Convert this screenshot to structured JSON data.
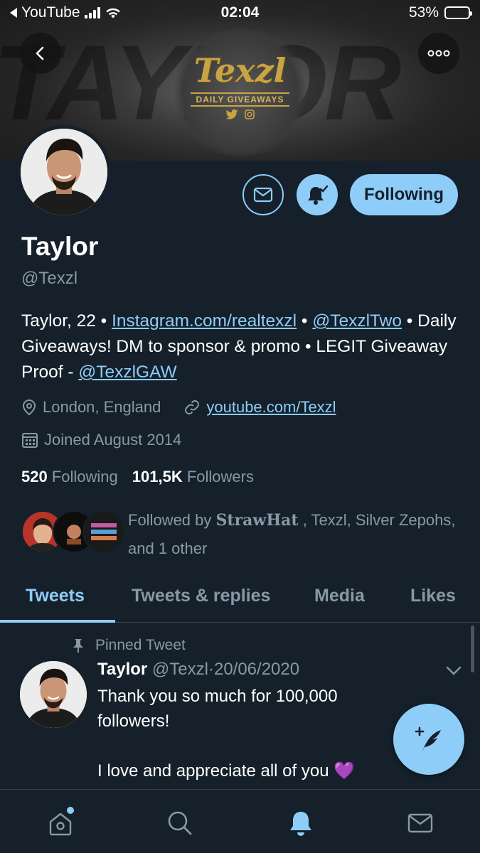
{
  "status_bar": {
    "back_app": "YouTube",
    "time": "02:04",
    "battery": "53%",
    "battery_level": 0.53
  },
  "banner": {
    "background_text": "TAYLOR",
    "logo_word": "Texzl",
    "logo_subtitle": "DAILY GIVEAWAYS"
  },
  "profile": {
    "name": "Taylor",
    "handle": "@Texzl",
    "bio": {
      "part1": "Taylor, 22 • ",
      "link1": "Instagram.com/realtexzl",
      "part2": " • ",
      "link2": "@TexzlTwo",
      "part3": " • Daily Giveaways! DM to sponsor & promo • LEGIT Giveaway Proof - ",
      "link3": "@TexzlGAW"
    },
    "location": "London, England",
    "website": "youtube.com/Texzl",
    "joined": "Joined August 2014",
    "following_count": "520",
    "following_label": "Following",
    "followers_count": "101,5K",
    "followers_label": "Followers",
    "followed_by": {
      "prefix": "Followed by ",
      "name1": "StrawHat",
      "rest": ", Texzl, Silver Zepohs, and 1 other"
    },
    "follow_button": "Following"
  },
  "tabs": [
    {
      "label": "Tweets",
      "active": true
    },
    {
      "label": "Tweets & replies",
      "active": false
    },
    {
      "label": "Media",
      "active": false
    },
    {
      "label": "Likes",
      "active": false
    }
  ],
  "pinned_tweet": {
    "pinned_label": "Pinned Tweet",
    "author": "Taylor",
    "handle": "@Texzl",
    "separator": "·",
    "date": "20/06/2020",
    "line1": "Thank you so much for 100,000 followers!",
    "line2": "I love and appreciate all of you",
    "emoji": "💜"
  },
  "colors": {
    "background": "#15202b",
    "accent": "#8ecdf8",
    "muted": "#8899a6",
    "gold": "#c9a444"
  },
  "icons": {
    "back": "chevron-left-icon",
    "more": "more-icon",
    "message": "mail-icon",
    "bell": "bell-check-icon",
    "location": "location-pin-icon",
    "link": "link-icon",
    "calendar": "calendar-icon",
    "pin": "pin-icon",
    "chevron": "chevron-down-icon",
    "compose": "compose-icon",
    "home": "home-icon",
    "search": "search-icon",
    "notifications": "bell-icon",
    "messages": "mail-icon"
  }
}
